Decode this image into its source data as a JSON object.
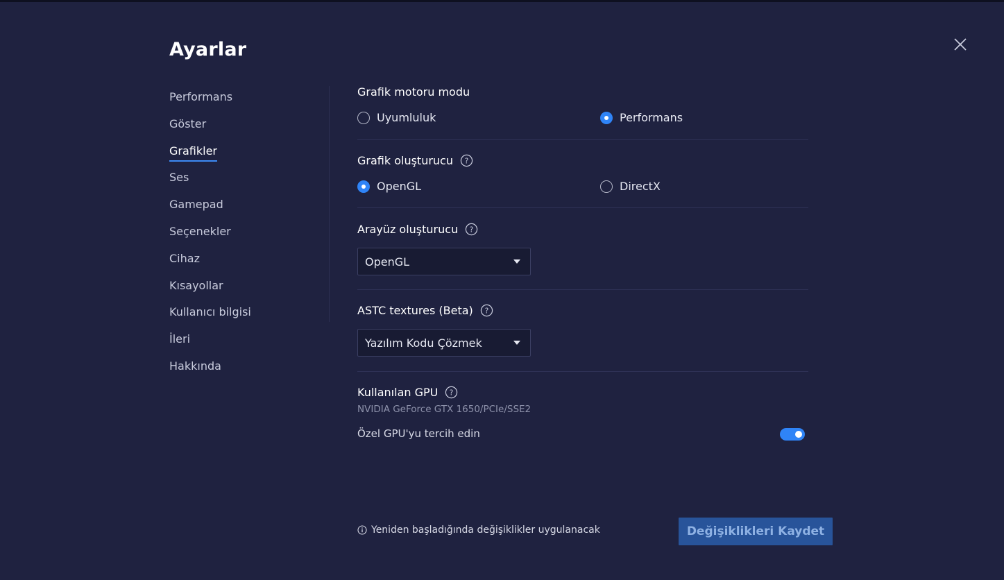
{
  "title": "Ayarlar",
  "sidebar": {
    "items": [
      {
        "label": "Performans"
      },
      {
        "label": "Göster"
      },
      {
        "label": "Grafikler"
      },
      {
        "label": "Ses"
      },
      {
        "label": "Gamepad"
      },
      {
        "label": "Seçenekler"
      },
      {
        "label": "Cihaz"
      },
      {
        "label": "Kısayollar"
      },
      {
        "label": "Kullanıcı bilgisi"
      },
      {
        "label": "İleri"
      },
      {
        "label": "Hakkında"
      }
    ],
    "active_index": 2
  },
  "graphics_engine_mode": {
    "title": "Grafik motoru modu",
    "options": [
      "Uyumluluk",
      "Performans"
    ],
    "selected": "Performans"
  },
  "graphics_renderer": {
    "title": "Grafik oluşturucu",
    "options": [
      "OpenGL",
      "DirectX"
    ],
    "selected": "OpenGL"
  },
  "interface_renderer": {
    "title": "Arayüz oluşturucu",
    "value": "OpenGL"
  },
  "astc_textures": {
    "title": "ASTC textures (Beta)",
    "value": "Yazılım Kodu Çözmek"
  },
  "gpu": {
    "title": "Kullanılan GPU",
    "name": "NVIDIA GeForce GTX 1650/PCIe/SSE2",
    "prefer_label": "Özel GPU'yu tercih edin",
    "prefer_enabled": true
  },
  "footer": {
    "notice": "Yeniden başladığında değişiklikler uygulanacak",
    "save_label": "Değişiklikleri Kaydet"
  },
  "colors": {
    "background": "#1f2240",
    "accent": "#2f84f7",
    "save_button": "#28549a"
  }
}
